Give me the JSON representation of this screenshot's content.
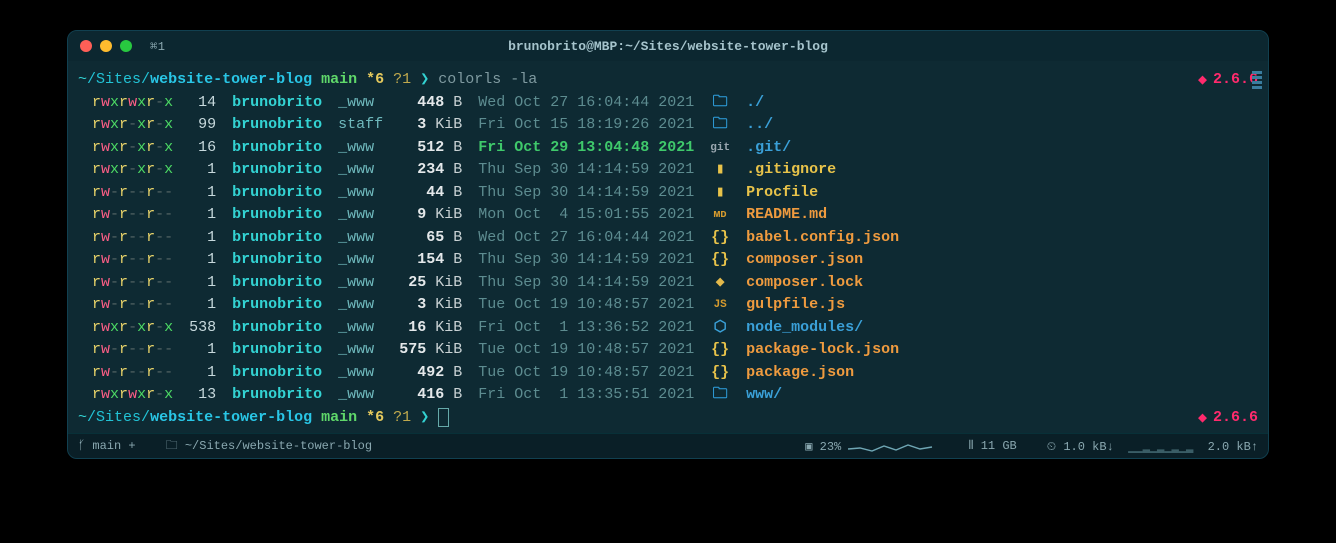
{
  "titlebar": {
    "tab": "⌘1",
    "title": "brunobrito@MBP:~/Sites/website-tower-blog"
  },
  "prompt": {
    "tilde": "~",
    "slash": "/",
    "dir1": "Sites",
    "dir2": "website-tower-blog",
    "branch": "main",
    "dirty": "*6",
    "untracked": "?1",
    "arrow": "❯",
    "command": "colorls -la",
    "ruby_version": "2.6.6"
  },
  "listing": [
    {
      "perm": [
        "rwx",
        "rwx",
        "r-x"
      ],
      "links": "14",
      "owner": "brunobrito",
      "group": "_www",
      "size": "448",
      "unit": "B",
      "date": "Wed Oct 27 16:04:44 2021",
      "hl": false,
      "icon": "folder",
      "iclass": "ic-blue",
      "name": "./",
      "nclass": "fn-blue"
    },
    {
      "perm": [
        "rwx",
        "r-x",
        "r-x"
      ],
      "links": "99",
      "owner": "brunobrito",
      "group": "staff",
      "size": "3",
      "unit": "KiB",
      "date": "Fri Oct 15 18:19:26 2021",
      "hl": false,
      "icon": "folder",
      "iclass": "ic-blue",
      "name": "../",
      "nclass": "fn-blue"
    },
    {
      "perm": [
        "rwx",
        "r-x",
        "r-x"
      ],
      "links": "16",
      "owner": "brunobrito",
      "group": "_www",
      "size": "512",
      "unit": "B",
      "date": "Fri Oct 29 13:04:48 2021",
      "hl": true,
      "icon": "git",
      "iclass": "ic-git",
      "name": ".git/",
      "nclass": "fn-blue"
    },
    {
      "perm": [
        "rwx",
        "r-x",
        "r-x"
      ],
      "links": "1",
      "owner": "brunobrito",
      "group": "_www",
      "size": "234",
      "unit": "B",
      "date": "Thu Sep 30 14:14:59 2021",
      "hl": false,
      "icon": "file",
      "iclass": "ic-yellow",
      "name": ".gitignore",
      "nclass": "fn-yellow"
    },
    {
      "perm": [
        "rw-",
        "r--",
        "r--"
      ],
      "links": "1",
      "owner": "brunobrito",
      "group": "_www",
      "size": "44",
      "unit": "B",
      "date": "Thu Sep 30 14:14:59 2021",
      "hl": false,
      "icon": "file",
      "iclass": "ic-yellow",
      "name": "Procfile",
      "nclass": "fn-yellow"
    },
    {
      "perm": [
        "rw-",
        "r--",
        "r--"
      ],
      "links": "1",
      "owner": "brunobrito",
      "group": "_www",
      "size": "9",
      "unit": "KiB",
      "date": "Mon Oct  4 15:01:55 2021",
      "hl": false,
      "icon": "md",
      "iclass": "ic-md",
      "name": "README.md",
      "nclass": "fn-orange"
    },
    {
      "perm": [
        "rw-",
        "r--",
        "r--"
      ],
      "links": "1",
      "owner": "brunobrito",
      "group": "_www",
      "size": "65",
      "unit": "B",
      "date": "Wed Oct 27 16:04:44 2021",
      "hl": false,
      "icon": "brace",
      "iclass": "ic-brace",
      "name": "babel.config.json",
      "nclass": "fn-orange"
    },
    {
      "perm": [
        "rw-",
        "r--",
        "r--"
      ],
      "links": "1",
      "owner": "brunobrito",
      "group": "_www",
      "size": "154",
      "unit": "B",
      "date": "Thu Sep 30 14:14:59 2021",
      "hl": false,
      "icon": "brace",
      "iclass": "ic-brace",
      "name": "composer.json",
      "nclass": "fn-orange"
    },
    {
      "perm": [
        "rw-",
        "r--",
        "r--"
      ],
      "links": "1",
      "owner": "brunobrito",
      "group": "_www",
      "size": "25",
      "unit": "KiB",
      "date": "Thu Sep 30 14:14:59 2021",
      "hl": false,
      "icon": "gem",
      "iclass": "ic-gem",
      "name": "composer.lock",
      "nclass": "fn-orange"
    },
    {
      "perm": [
        "rw-",
        "r--",
        "r--"
      ],
      "links": "1",
      "owner": "brunobrito",
      "group": "_www",
      "size": "3",
      "unit": "KiB",
      "date": "Tue Oct 19 10:48:57 2021",
      "hl": false,
      "icon": "js",
      "iclass": "ic-js",
      "name": "gulpfile.js",
      "nclass": "fn-orange"
    },
    {
      "perm": [
        "rwx",
        "r-x",
        "r-x"
      ],
      "links": "538",
      "owner": "brunobrito",
      "group": "_www",
      "size": "16",
      "unit": "KiB",
      "date": "Fri Oct  1 13:36:52 2021",
      "hl": false,
      "icon": "node",
      "iclass": "ic-node",
      "name": "node_modules/",
      "nclass": "fn-blue"
    },
    {
      "perm": [
        "rw-",
        "r--",
        "r--"
      ],
      "links": "1",
      "owner": "brunobrito",
      "group": "_www",
      "size": "575",
      "unit": "KiB",
      "date": "Tue Oct 19 10:48:57 2021",
      "hl": false,
      "icon": "brace",
      "iclass": "ic-brace",
      "name": "package-lock.json",
      "nclass": "fn-orange"
    },
    {
      "perm": [
        "rw-",
        "r--",
        "r--"
      ],
      "links": "1",
      "owner": "brunobrito",
      "group": "_www",
      "size": "492",
      "unit": "B",
      "date": "Tue Oct 19 10:48:57 2021",
      "hl": false,
      "icon": "brace",
      "iclass": "ic-brace",
      "name": "package.json",
      "nclass": "fn-orange"
    },
    {
      "perm": [
        "rwx",
        "rwx",
        "r-x"
      ],
      "links": "13",
      "owner": "brunobrito",
      "group": "_www",
      "size": "416",
      "unit": "B",
      "date": "Fri Oct  1 13:35:51 2021",
      "hl": false,
      "icon": "folder",
      "iclass": "ic-blue",
      "name": "www/",
      "nclass": "fn-blue"
    }
  ],
  "status": {
    "branch": " main +",
    "path": "~/Sites/website-tower-blog",
    "cpu": "23%",
    "ram": "11 GB",
    "net_down": "1.0 kB↓",
    "net_up": "2.0 kB↑"
  },
  "icons": {
    "folder": "🗀",
    "git": "git",
    "file": "▮",
    "md": "ᴍᴅ",
    "brace": "{}",
    "gem": "◆",
    "js": "JS",
    "node": "⬡",
    "branch": "ᚶ",
    "folder_small": "🗀",
    "chip": "▣",
    "bars": "⫴",
    "gauge": "⏲"
  }
}
